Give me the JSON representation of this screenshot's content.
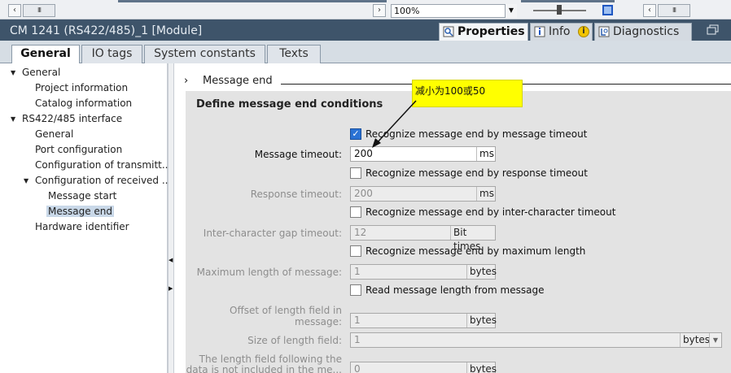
{
  "toolbar": {
    "scroll_thumb": "III",
    "zoom_value": "100%",
    "zoom_dropdown": "▼",
    "scroll_thumb_right": "III"
  },
  "titlebar": {
    "title": "CM 1241 (RS422/485)_1 [Module]",
    "tabs": [
      {
        "label": "Properties"
      },
      {
        "label": "Info"
      },
      {
        "label": "Diagnostics"
      }
    ],
    "info_badge": "i"
  },
  "inspector_tabs": [
    {
      "label": "General"
    },
    {
      "label": "IO tags"
    },
    {
      "label": "System constants"
    },
    {
      "label": "Texts"
    }
  ],
  "tree": {
    "general": "General",
    "project_information": "Project information",
    "catalog_information": "Catalog information",
    "rs_interface": "RS422/485 interface",
    "if_general": "General",
    "port_configuration": "Port configuration",
    "config_transmit": "Configuration of transmitt...",
    "config_received": "Configuration of received ...",
    "message_start": "Message start",
    "message_end": "Message end",
    "hardware_identifier": "Hardware identifier"
  },
  "section": {
    "marker": "›",
    "title": "Message end"
  },
  "form": {
    "title": "Define message end conditions",
    "msg_timeout_check": {
      "label": "Recognize message end by message timeout",
      "checked": true
    },
    "message_timeout": {
      "label": "Message timeout:",
      "value": "200",
      "unit": "ms"
    },
    "resp_timeout_check": {
      "label": "Recognize message end by response timeout",
      "checked": false
    },
    "response_timeout": {
      "label": "Response timeout:",
      "value": "200",
      "unit": "ms"
    },
    "inter_char_check": {
      "label": "Recognize message end by inter-character timeout",
      "checked": false
    },
    "inter_char_gap": {
      "label": "Inter-character gap timeout:",
      "value": "12",
      "unit": "Bit times"
    },
    "max_length_check": {
      "label": "Recognize message end by maximum length",
      "checked": false
    },
    "max_length": {
      "label": "Maximum length of message:",
      "value": "1",
      "unit": "bytes"
    },
    "read_length_check": {
      "label": "Read message length from message",
      "checked": false
    },
    "offset_length": {
      "label_line1": "Offset of length field in",
      "label_line2": "message:",
      "value": "1",
      "unit": "bytes"
    },
    "size_length": {
      "label": "Size of length field:",
      "value": "1",
      "unit": "bytes"
    },
    "following_length": {
      "label_line1": "The length field following the",
      "label_line2": "data is not included in the me...",
      "value": "0",
      "unit": "bytes"
    }
  },
  "annotation": {
    "text": "减小为100或50",
    "color": "#ffff00"
  },
  "colors": {
    "titlebar": "#3e546a",
    "checkbox_on": "#2a72d4",
    "selection": "#c9d8e8"
  }
}
